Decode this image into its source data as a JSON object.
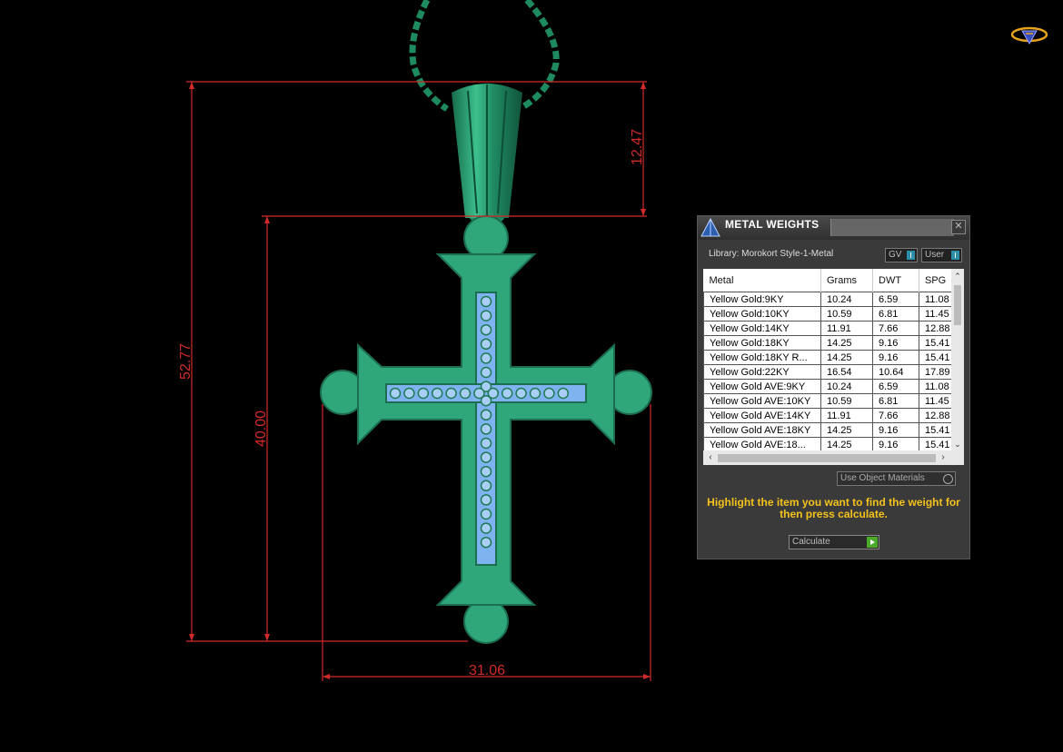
{
  "dimensions": {
    "total_height": "52.77",
    "body_height": "40.00",
    "bail_height": "12.47",
    "width": "31.06"
  },
  "colors": {
    "dimension_line": "#d22a2a",
    "metal": "#2fa77a",
    "gem": "#7fb3f0",
    "panel_bg": "#3a3a3a",
    "hint_text": "#f4c21c",
    "calculate_play": "#4caa2a"
  },
  "panel": {
    "title": "METAL WEIGHTS",
    "close_icon": "close-icon",
    "library_label": "Library: Morokort Style-1-Metal",
    "toggle_gv": "GV",
    "toggle_user": "User",
    "columns": [
      "Metal",
      "Grams",
      "DWT",
      "SPG"
    ],
    "rows": [
      [
        "Yellow Gold:9KY",
        "10.24",
        "6.59",
        "11.08"
      ],
      [
        "Yellow Gold:10KY",
        "10.59",
        "6.81",
        "11.45"
      ],
      [
        "Yellow Gold:14KY",
        "11.91",
        "7.66",
        "12.88"
      ],
      [
        "Yellow Gold:18KY",
        "14.25",
        "9.16",
        "15.41"
      ],
      [
        "Yellow Gold:18KY R...",
        "14.25",
        "9.16",
        "15.41"
      ],
      [
        "Yellow Gold:22KY",
        "16.54",
        "10.64",
        "17.89"
      ],
      [
        "Yellow Gold AVE:9KY",
        "10.24",
        "6.59",
        "11.08"
      ],
      [
        "Yellow Gold AVE:10KY",
        "10.59",
        "6.81",
        "11.45"
      ],
      [
        "Yellow Gold AVE:14KY",
        "11.91",
        "7.66",
        "12.88"
      ],
      [
        "Yellow Gold AVE:18KY",
        "14.25",
        "9.16",
        "15.41"
      ],
      [
        "Yellow Gold AVE:18...",
        "14.25",
        "9.16",
        "15.41"
      ]
    ],
    "use_object_materials": "Use Object Materials",
    "hint": "Highlight the item you want to find the weight for then press calculate.",
    "calculate_label": "Calculate"
  }
}
